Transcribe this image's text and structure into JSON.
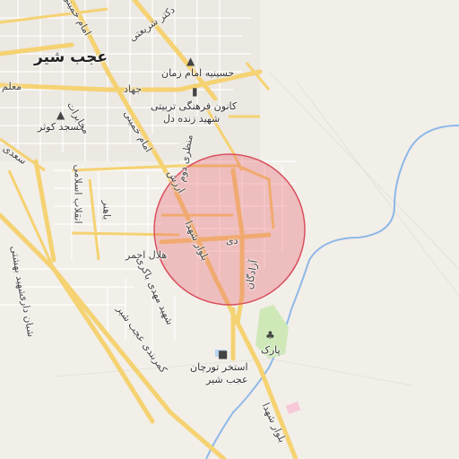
{
  "map": {
    "city_label": "عجب شیر",
    "pois": {
      "hosseinieh": "حسینیه امام زمان",
      "kanun_line1": "کانون فرهنگی تربیتی",
      "kanun_line2": "شهید زنده دل",
      "mosque": "مسجد کوثر",
      "park": "پارک",
      "pool_line1": "استخر تورچان",
      "pool_line2": "عجب شیر"
    },
    "roads": {
      "jahad": "جهاد",
      "moallem": "معلم",
      "saadi": "سعدی",
      "dr_shariati": "دکتر شریعتی",
      "imam_khomeini_top": "امام خمینی",
      "imam_khomeini": "امام خمینی",
      "manzari": "منظری دوم",
      "mokhaberat": "مخابرات",
      "arzesh": "ارزش",
      "enghelab": "انقلاب اسلامی",
      "bahonar": "باهنر",
      "shahid_beheshti": "شهید بهشتی",
      "helal_ahmar": "هلال احمر",
      "bolvar_shohada": "بلوار شهدا",
      "dey": "دی",
      "azadegan": "آزادگان",
      "mahdi_bakeri": "شهید مهدی باکری",
      "kamarbandi": "کمربندی عجب شیر",
      "shaban_dari": "شبان داری"
    },
    "icons": {
      "mosque": "mosque-icon",
      "school": "school-icon",
      "park": "tree-icon",
      "pool": "pool-icon"
    },
    "colors": {
      "background": "#f2efe9",
      "major_road": "#f5d272",
      "minor_road": "#ffffff",
      "block": "#e6e2dc",
      "river": "#8fb8e8",
      "park": "#cfe8b8",
      "circle_fill": "#e8606e",
      "circle_stroke": "#d9505e"
    }
  }
}
